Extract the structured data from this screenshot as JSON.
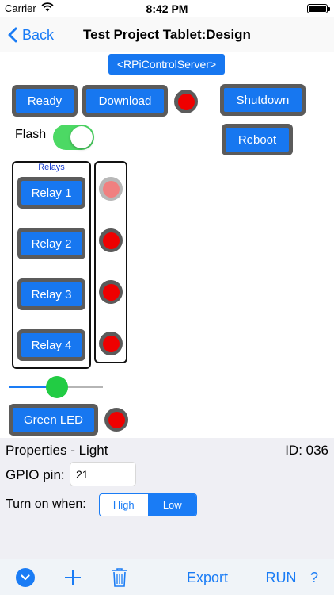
{
  "status_bar": {
    "carrier": "Carrier",
    "time": "8:42 PM"
  },
  "nav": {
    "back_label": "Back",
    "title": "Test Project Tablet:Design"
  },
  "canvas": {
    "server_tag": "<RPiControlServer>",
    "buttons": {
      "ready": "Ready",
      "download": "Download",
      "shutdown": "Shutdown",
      "reboot": "Reboot",
      "green_led": "Green LED"
    },
    "flash": {
      "label": "Flash",
      "on": true
    },
    "relays_group_label": "Relays",
    "relays": [
      "Relay 1",
      "Relay 2",
      "Relay 3",
      "Relay 4"
    ],
    "slider_value": 0.43,
    "led_color": "#ee0000",
    "led_dim_color": "#f08080"
  },
  "properties": {
    "title": "Properties - Light",
    "id": "ID: 036",
    "gpio_label": "GPIO pin:",
    "gpio_value": "21",
    "turn_on_label": "Turn on when:",
    "options": [
      "High",
      "Low"
    ],
    "selected": "Low"
  },
  "toolbar": {
    "export": "Export",
    "run": "RUN",
    "help": "?",
    "icons": [
      "chevron-down-circle-icon",
      "plus-icon",
      "trash-icon"
    ]
  },
  "colors": {
    "accent": "#1a7cf5",
    "button_blue": "#1777f0",
    "button_border": "#5b5b5b",
    "toggle_on": "#4cd964",
    "slider_thumb": "#22cc44"
  }
}
